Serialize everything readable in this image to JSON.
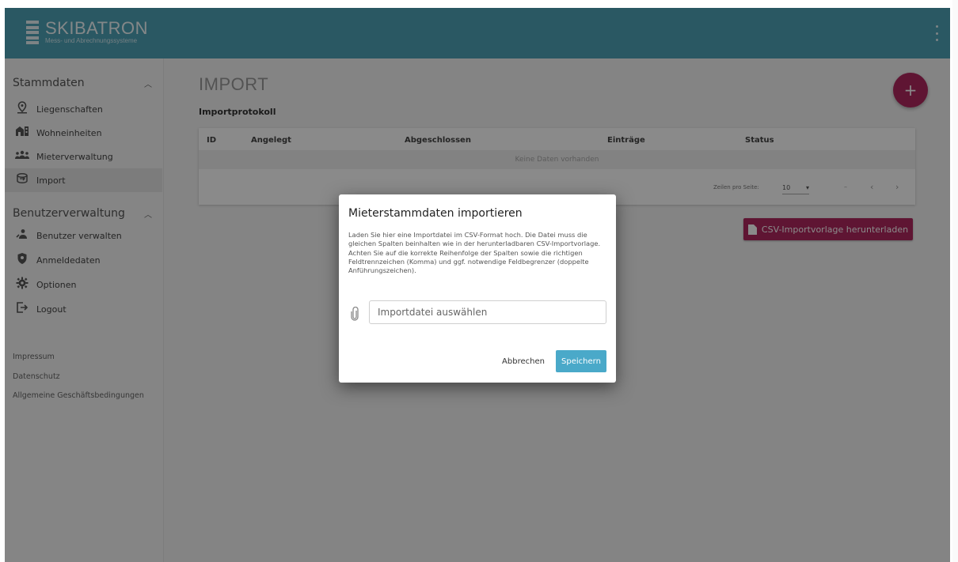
{
  "header": {
    "brand": "SKIBATRON",
    "tagline": "Mess- und Abrechnungssysteme"
  },
  "sidebar": {
    "group1": "Stammdaten",
    "items1": [
      {
        "label": "Liegenschaften",
        "icon": "location-pin-icon"
      },
      {
        "label": "Wohneinheiten",
        "icon": "buildings-icon"
      },
      {
        "label": "Mieterverwaltung",
        "icon": "people-icon"
      },
      {
        "label": "Import",
        "icon": "import-icon"
      }
    ],
    "group2": "Benutzerverwaltung",
    "items2": [
      {
        "label": "Benutzer verwalten",
        "icon": "user-manage-icon"
      },
      {
        "label": "Anmeldedaten",
        "icon": "shield-icon"
      },
      {
        "label": "Optionen",
        "icon": "gear-icon"
      },
      {
        "label": "Logout",
        "icon": "logout-icon"
      }
    ],
    "footer": [
      "Impressum",
      "Datenschutz",
      "Allgemeine Geschäftsbedingungen"
    ]
  },
  "main": {
    "title": "IMPORT",
    "section": "Importprotokoll",
    "fab": "+",
    "columns": [
      "ID",
      "Angelegt",
      "Abgeschlossen",
      "Einträge",
      "Status"
    ],
    "empty": "Keine Daten vorhanden",
    "pager": {
      "label": "Zeilen pro Seite:",
      "value": "10",
      "range": "–",
      "prev": "‹",
      "next": "›"
    },
    "csv_button": "CSV-Importvorlage herunterladen"
  },
  "dialog": {
    "title": "Mieterstammdaten importieren",
    "text": "Laden Sie hier eine Importdatei im CSV-Format hoch. Die Datei muss die gleichen Spalten beinhalten wie in der herunterladbaren CSV-Importvorlage. Achten Sie auf die korrekte Reihenfolge der Spalten sowie die richtigen Feldtrennzeichen (Komma) und ggf. notwendige Feldbegrenzer (doppelte Anführungszeichen).",
    "file_placeholder": "Importdatei auswählen",
    "cancel": "Abbrechen",
    "save": "Speichern"
  },
  "colors": {
    "header": "#4fa3b8",
    "accent": "#b0275e",
    "primary_button": "#4aa9c9"
  }
}
